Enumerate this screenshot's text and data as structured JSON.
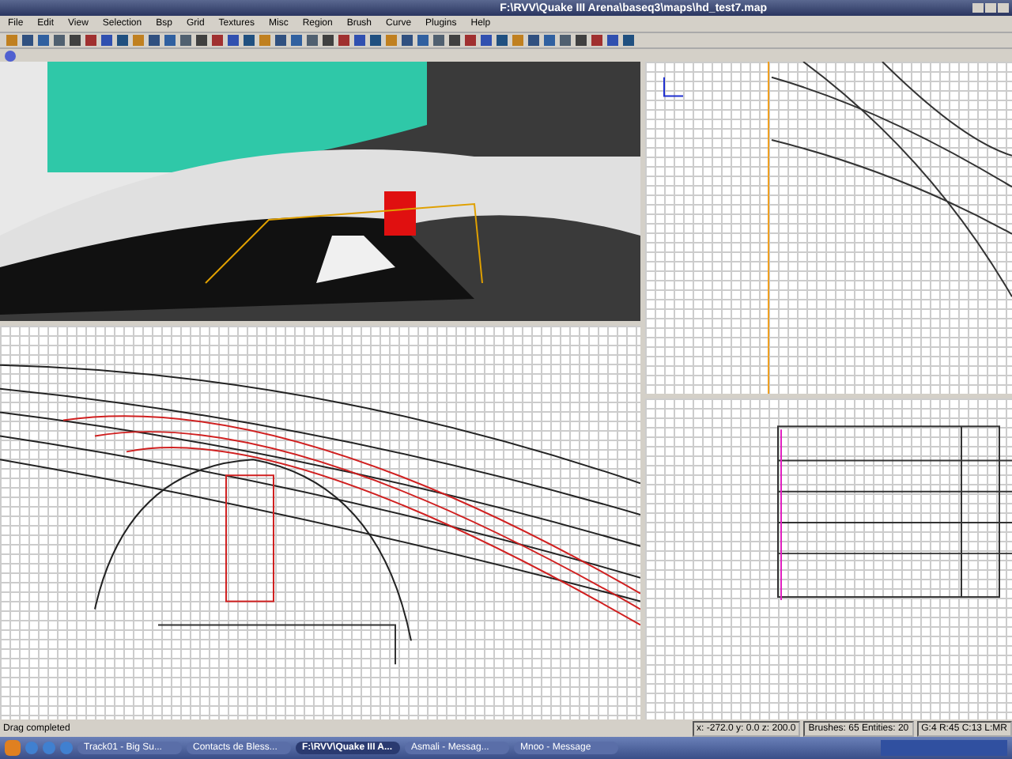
{
  "window": {
    "title": "F:\\RVV\\Quake III Arena\\baseq3\\maps\\hd_test7.map"
  },
  "menu": [
    "File",
    "Edit",
    "View",
    "Selection",
    "Bsp",
    "Grid",
    "Textures",
    "Misc",
    "Region",
    "Brush",
    "Curve",
    "Plugins",
    "Help"
  ],
  "status_bar": {
    "message": "Drag completed",
    "coords": "x: -272.0  y: 0.0  z: 200.0",
    "counts": "Brushes: 65 Entities: 20",
    "grid": "G:4 R:45 C:13 L:MR"
  },
  "taskbar": {
    "tasks": [
      {
        "label": "Track01 - Big Su...",
        "selected": false
      },
      {
        "label": "Contacts de Bless...",
        "selected": false
      },
      {
        "label": "F:\\RVV\\Quake III A...",
        "selected": true
      },
      {
        "label": "Asmali - Messag...",
        "selected": false
      },
      {
        "label": "Mnoo - Message",
        "selected": false
      }
    ]
  }
}
